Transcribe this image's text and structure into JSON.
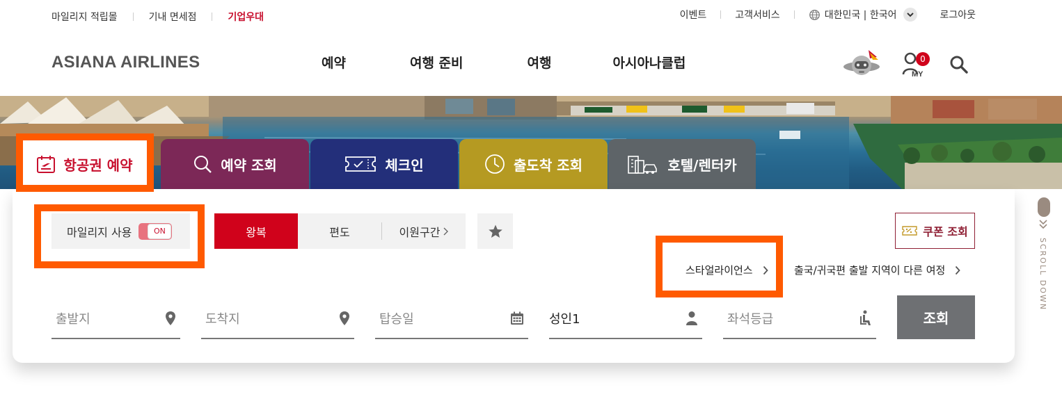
{
  "util": {
    "left": [
      "마일리지 적립몰",
      "기내 면세점",
      "기업우대"
    ],
    "event": "이벤트",
    "service": "고객서비스",
    "lang": "대한민국 | 한국어",
    "logout": "로그아웃"
  },
  "header": {
    "logo": "ASIANA AIRLINES",
    "menu": [
      "예약",
      "여행 준비",
      "여행",
      "아시아나클럽"
    ],
    "my_count": "0",
    "my_label": "MY"
  },
  "tabs": [
    "항공권 예약",
    "예약 조회",
    "체크인",
    "출도착 조회",
    "호텔/렌터카"
  ],
  "booking": {
    "mileage_label": "마일리지 사용",
    "toggle": "ON",
    "trip_types": [
      "왕복",
      "편도",
      "이원구간"
    ],
    "coupon": "쿠폰 조회",
    "star_alliance": "스타얼라이언스",
    "open_jaw": "출국/귀국편 출발 지역이 다른 여정",
    "fields": {
      "departure": "출발지",
      "arrival": "도착지",
      "date": "탑승일",
      "passengers": "성인1",
      "cabin": "좌석등급"
    },
    "search": "조회"
  },
  "scroll_label": "SCROLL DOWN",
  "colors": {
    "brand_red": "#d0021b",
    "highlight": "#ff5a00",
    "tab_check": "#7c2857",
    "tab_checkin": "#232f7a",
    "tab_status": "#b59a22",
    "tab_hotel": "#5e6468"
  }
}
